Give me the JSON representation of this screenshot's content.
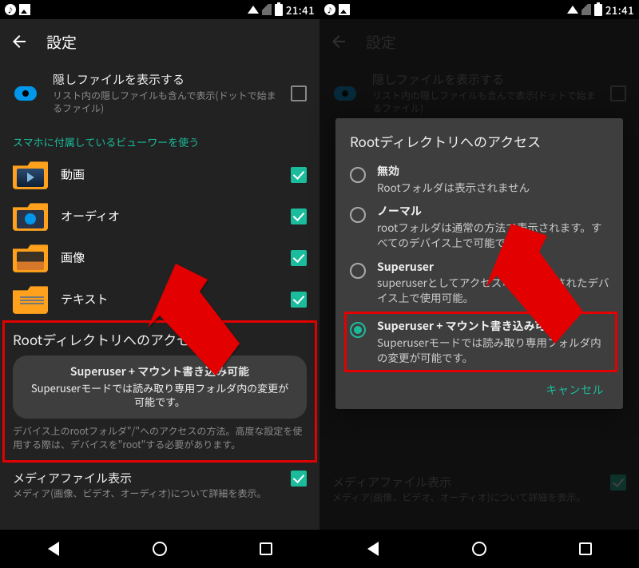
{
  "status": {
    "time": "21:41"
  },
  "appbar": {
    "title": "設定"
  },
  "hidden_files": {
    "title": "隠しファイルを表示する",
    "sub": "リスト内の隠しファイルも含んで表示(ドットで始まるファイル)"
  },
  "viewer_section": "スマホに付属しているビューワーを使う",
  "types": {
    "video": "動画",
    "audio": "オーディオ",
    "image": "画像",
    "text": "テキスト"
  },
  "root": {
    "title": "Rootディレクトリへのアクセス",
    "pill_head": "Superuser + マウント書き込み可能",
    "pill_body": "Superuserモードでは読み取り専用フォルダ内の変更が可能です。",
    "desc": "デバイス上のrootフォルダ\"/\"へのアクセスの方法。高度な設定を使用する際は、デバイスを\"root\"する必要があります。"
  },
  "media": {
    "title": "メディアファイル表示",
    "sub": "メディア(画像、ビデオ、オーディオ)について詳細を表示。"
  },
  "dialog": {
    "title": "Rootディレクトリへのアクセス",
    "opts": [
      {
        "head": "無効",
        "sub": "Rootフォルダは表示されません"
      },
      {
        "head": "ノーマル",
        "sub": "rootフォルダは通常の方法で表示されます。すべてのデバイス上で可能です。"
      },
      {
        "head": "Superuser",
        "sub": "superuserとしてアクセス可能。rootされたデバイス上で使用可能。"
      },
      {
        "head": "Superuser + マウント書き込み可能",
        "sub": "Superuserモードでは読み取り専用フォルダ内の変更が可能です。"
      }
    ],
    "cancel": "キャンセル"
  }
}
